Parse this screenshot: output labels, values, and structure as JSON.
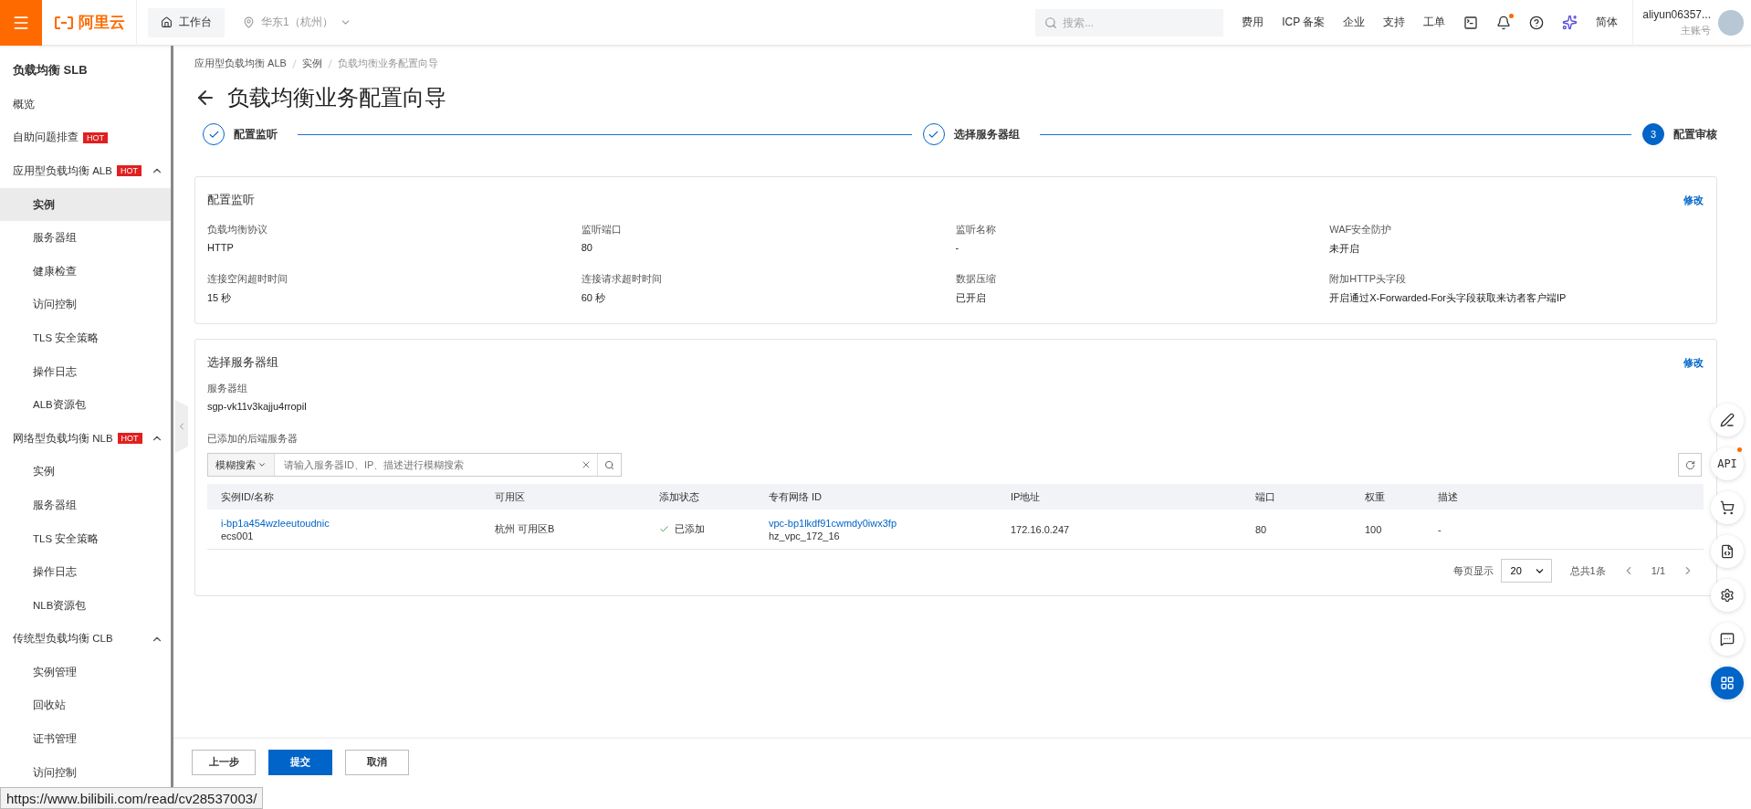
{
  "topbar": {
    "logo": "阿里云",
    "workbench": "工作台",
    "region": "华东1（杭州）",
    "search_placeholder": "搜索...",
    "links": [
      "费用",
      "ICP 备案",
      "企业",
      "支持",
      "工单"
    ],
    "notification_dot": true,
    "language": "简体",
    "user": "aliyun06357...",
    "account_type": "主账号"
  },
  "sidebar": {
    "title": "负载均衡 SLB",
    "items": [
      {
        "label": "概览",
        "selected": false
      },
      {
        "label": "自助问题排查",
        "badge": "HOT",
        "selected": false
      },
      {
        "label": "应用型负载均衡 ALB",
        "badge": "HOT",
        "expanded": true,
        "selected": false,
        "children": [
          {
            "label": "实例",
            "selected": true
          },
          {
            "label": "服务器组",
            "selected": false
          },
          {
            "label": "健康检查",
            "selected": false
          },
          {
            "label": "访问控制",
            "selected": false
          },
          {
            "label": "TLS 安全策略",
            "selected": false
          },
          {
            "label": "操作日志",
            "selected": false
          },
          {
            "label": "ALB资源包",
            "selected": false
          }
        ]
      },
      {
        "label": "网络型负载均衡 NLB",
        "badge": "HOT",
        "expanded": true,
        "selected": false,
        "children": [
          {
            "label": "实例",
            "selected": false
          },
          {
            "label": "服务器组",
            "selected": false
          },
          {
            "label": "TLS 安全策略",
            "selected": false
          },
          {
            "label": "操作日志",
            "selected": false
          },
          {
            "label": "NLB资源包",
            "selected": false
          }
        ]
      },
      {
        "label": "传统型负载均衡 CLB",
        "expanded": true,
        "selected": false,
        "children": [
          {
            "label": "实例管理",
            "selected": false
          },
          {
            "label": "回收站",
            "selected": false
          },
          {
            "label": "证书管理",
            "selected": false
          },
          {
            "label": "访问控制",
            "selected": false
          }
        ]
      }
    ]
  },
  "breadcrumb": [
    "应用型负载均衡 ALB",
    "实例",
    "负载均衡业务配置向导"
  ],
  "page_title": "负载均衡业务配置向导",
  "steps": [
    {
      "label": "配置监听",
      "done": true
    },
    {
      "label": "选择服务器组",
      "done": true
    },
    {
      "label": "配置审核",
      "number": "3",
      "done": false
    }
  ],
  "listener_card": {
    "title": "配置监听",
    "edit": "修改",
    "fields": [
      {
        "label": "负载均衡协议",
        "value": "HTTP"
      },
      {
        "label": "监听端口",
        "value": "80"
      },
      {
        "label": "监听名称",
        "value": "-"
      },
      {
        "label": "WAF安全防护",
        "value": "未开启"
      },
      {
        "label": "连接空闲超时时间",
        "value": "15 秒"
      },
      {
        "label": "连接请求超时时间",
        "value": "60 秒"
      },
      {
        "label": "数据压缩",
        "value": "已开启"
      },
      {
        "label": "附加HTTP头字段",
        "value": "开启通过X-Forwarded-For头字段获取来访者客户端IP"
      }
    ]
  },
  "server_card": {
    "title": "选择服务器组",
    "edit": "修改",
    "group_label": "服务器组",
    "group_value": "sgp-vk11v3kajju4rropil",
    "backend_label": "已添加的后端服务器",
    "search_mode": "模糊搜索",
    "search_placeholder": "请输入服务器ID、IP、描述进行模糊搜索",
    "table": {
      "columns": [
        "实例ID/名称",
        "可用区",
        "添加状态",
        "专有网络 ID",
        "IP地址",
        "端口",
        "权重",
        "描述"
      ],
      "rows": [
        {
          "instance_id": "i-bp1a454wzleeutoudnic",
          "instance_name": "ecs001",
          "zone": "杭州 可用区B",
          "status": "已添加",
          "added": true,
          "vpc_id": "vpc-bp1lkdf91cwmdy0iwx3fp",
          "vpc_name": "hz_vpc_172_16",
          "ip": "172.16.0.247",
          "port": "80",
          "weight": "100",
          "description": "-"
        }
      ]
    },
    "pagination": {
      "page_size_label": "每页显示",
      "page_size": "20",
      "total": "总共1条",
      "page": "1/1"
    }
  },
  "right_toolbar": {
    "api_label": "API",
    "api_dot": true
  },
  "footer": {
    "buttons": [
      {
        "label": "上一步",
        "kind": "default"
      },
      {
        "label": "提交",
        "kind": "primary"
      },
      {
        "label": "取消",
        "kind": "default"
      }
    ]
  },
  "status_url": "https://www.bilibili.com/read/cv28537003/"
}
